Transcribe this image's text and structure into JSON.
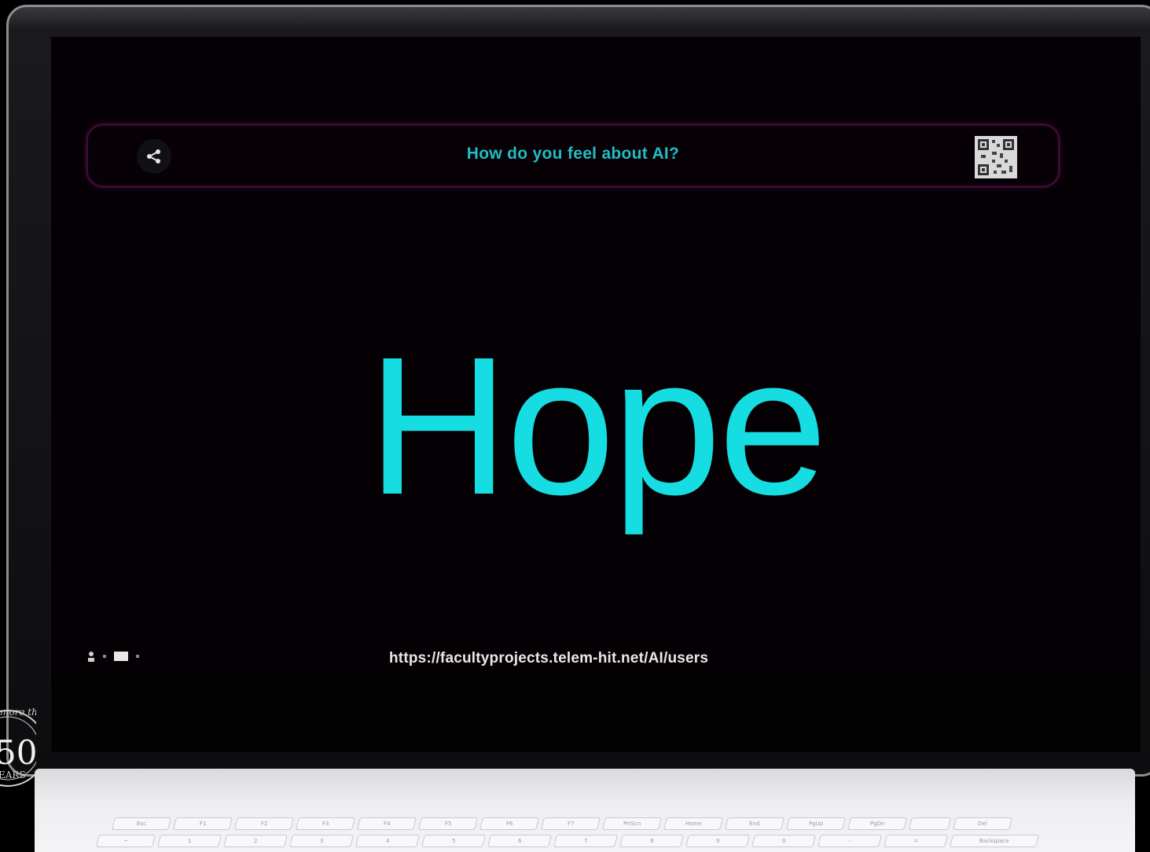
{
  "app": {
    "header": {
      "share_icon": "share-icon",
      "title": "How do you feel about AI?",
      "qr_icon": "qr-code-icon"
    },
    "main_word": "Hope",
    "footer": {
      "controls": [
        "person-icon",
        "screen-icon"
      ],
      "url": "https://facultyprojects.telem-hit.net/AI/users"
    }
  },
  "colors": {
    "accent_cyan": "#16dde1",
    "title_cyan": "#1fbfc4",
    "pill_border": "#3a0a36",
    "screen_bg": "#050004"
  },
  "keyboard": {
    "function_row": [
      "Esc",
      "F1",
      "F2",
      "F3",
      "F4",
      "F5",
      "F6",
      "F7",
      "PrtScn",
      "Home",
      "End",
      "PgUp",
      "PgDn",
      "",
      "Del"
    ],
    "number_row": [
      "~",
      "1",
      "2",
      "3",
      "4",
      "5",
      "6",
      "7",
      "8",
      "9",
      "0",
      "-",
      "=",
      "Backspace"
    ]
  },
  "emblem": {
    "text_top": "more th",
    "number": "50",
    "text_mid": "EARS"
  }
}
